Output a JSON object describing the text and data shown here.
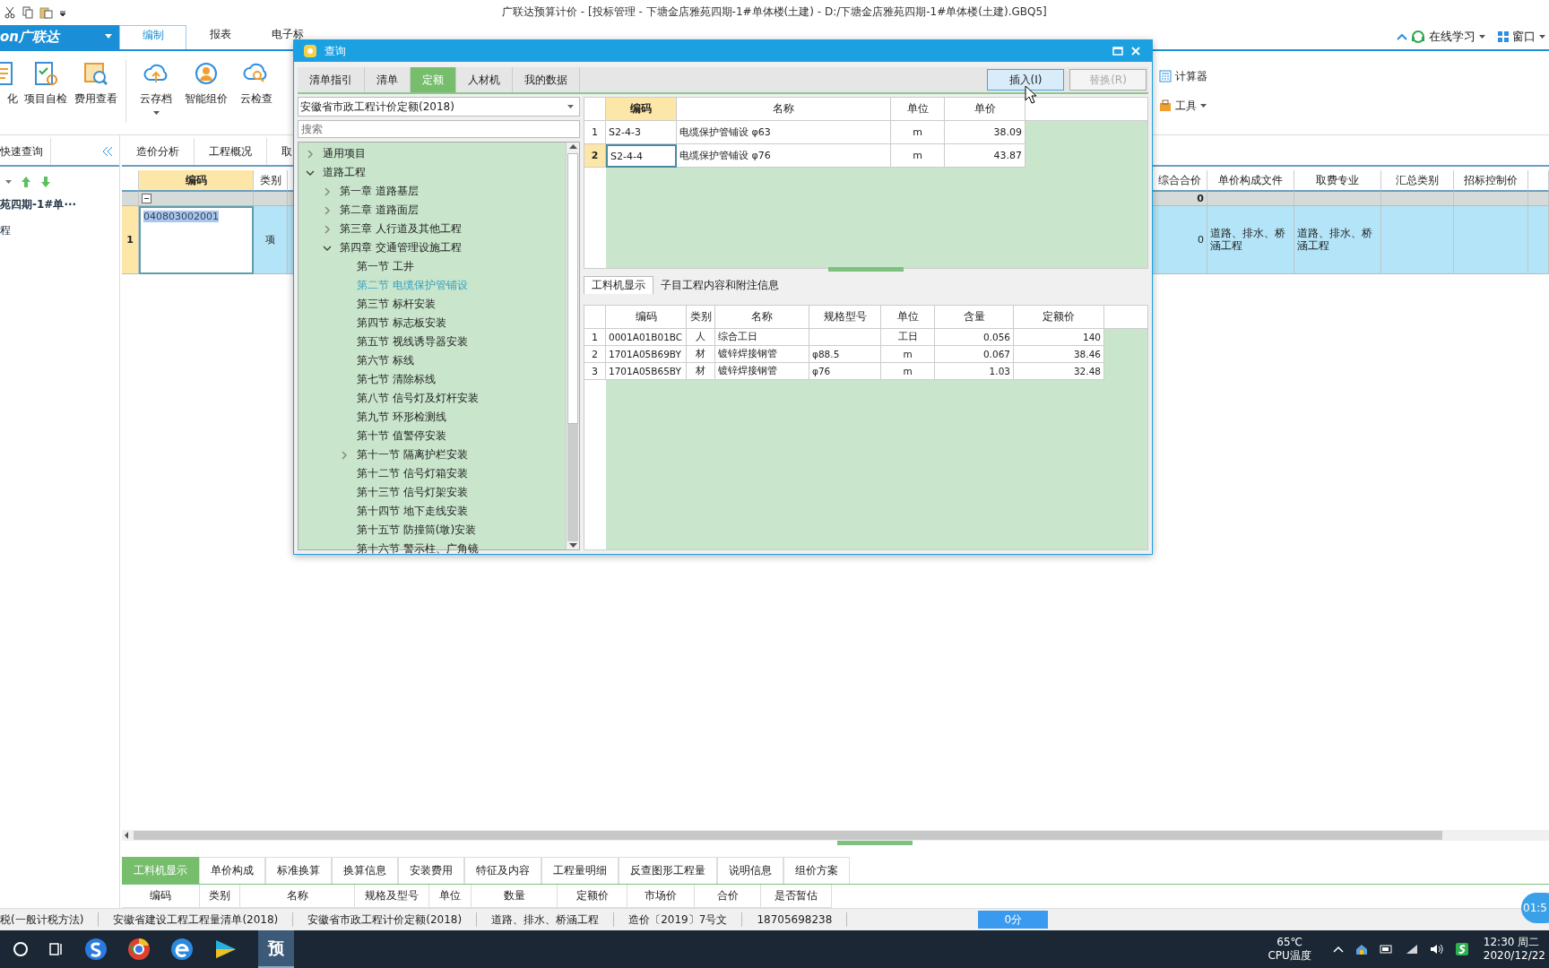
{
  "window": {
    "title": "广联达预算计价 - [投标管理 - 下塘金店雅苑四期-1#单体楼(土建) - D:/下塘金店雅苑四期-1#单体楼(土建).GBQ5]"
  },
  "menu": {
    "brand": "on广联达",
    "tabs": [
      {
        "label": "编制",
        "selected": true
      },
      {
        "label": "报表",
        "selected": false
      },
      {
        "label": "电子标",
        "selected": false
      }
    ],
    "right": [
      {
        "label": "在线学习",
        "kind": "learn"
      },
      {
        "label": "窗口",
        "kind": "window"
      }
    ]
  },
  "ribbon": {
    "left": [
      {
        "label": "化",
        "kind": "doc",
        "dropdown": false
      },
      {
        "label": "项目自检",
        "kind": "check",
        "dropdown": false
      },
      {
        "label": "费用查看",
        "kind": "view",
        "dropdown": false
      },
      {
        "label": "云存档",
        "kind": "cloud",
        "dropdown": true
      },
      {
        "label": "智能组价",
        "kind": "smart",
        "dropdown": false
      },
      {
        "label": "云检查",
        "kind": "cloudcheck",
        "dropdown": false
      }
    ],
    "right": [
      {
        "label": "计算器",
        "kind": "calc",
        "dropdown": false
      },
      {
        "label": "工具",
        "kind": "tools",
        "dropdown": true
      }
    ]
  },
  "left_panel": {
    "tab": "快速查询",
    "tree": [
      {
        "label": "苑四期-1#单···",
        "bold": true
      },
      {
        "label": "程",
        "bold": false
      }
    ]
  },
  "sheet_tabs": [
    "造价分析",
    "工程概况",
    "取"
  ],
  "main_table": {
    "columns": [
      {
        "label": "编码",
        "selected": true
      },
      {
        "label": "类别",
        "selected": false
      },
      {
        "label": "综合合价",
        "selected": false
      },
      {
        "label": "单价构成文件",
        "selected": false
      },
      {
        "label": "取费专业",
        "selected": false
      },
      {
        "label": "汇总类别",
        "selected": false
      },
      {
        "label": "招标控制价",
        "selected": false
      }
    ],
    "rows": [
      {
        "kind": "group",
        "total": "0",
        "expanded": true
      },
      {
        "kind": "item",
        "num": "1",
        "code": "040803002001",
        "type": "项",
        "total": "0",
        "price_file": "道路、排水、桥涵工程",
        "fee_type": "道路、排水、桥涵工程",
        "selected": true
      }
    ]
  },
  "dialog": {
    "title": "查询",
    "tabs": [
      {
        "label": "清单指引",
        "selected": false
      },
      {
        "label": "清单",
        "selected": false
      },
      {
        "label": "定额",
        "selected": true
      },
      {
        "label": "人材机",
        "selected": false
      },
      {
        "label": "我的数据",
        "selected": false
      }
    ],
    "buttons": [
      {
        "label": "插入(I)",
        "disabled": false,
        "hover": true
      },
      {
        "label": "替换(R)",
        "disabled": true,
        "hover": false
      }
    ],
    "library": "安徽省市政工程计价定额(2018)",
    "search": {
      "placeholder": "搜索"
    },
    "tree": [
      {
        "label": "通用项目",
        "expanded": false,
        "selected": false
      },
      {
        "label": "道路工程",
        "expanded": true,
        "selected": false,
        "children": [
          {
            "label": "第一章  道路基层",
            "expanded": false,
            "selected": false
          },
          {
            "label": "第二章  道路面层",
            "expanded": false,
            "selected": false
          },
          {
            "label": "第三章  人行道及其他工程",
            "expanded": false,
            "selected": false
          },
          {
            "label": "第四章  交通管理设施工程",
            "expanded": true,
            "selected": false,
            "children": [
              {
                "label": "第一节  工井",
                "selected": false
              },
              {
                "label": "第二节  电缆保护管铺设",
                "selected": true
              },
              {
                "label": "第三节  标杆安装",
                "selected": false
              },
              {
                "label": "第四节  标志板安装",
                "selected": false
              },
              {
                "label": "第五节  视线诱导器安装",
                "selected": false
              },
              {
                "label": "第六节  标线",
                "selected": false
              },
              {
                "label": "第七节  清除标线",
                "selected": false
              },
              {
                "label": "第八节  信号灯及灯杆安装",
                "selected": false
              },
              {
                "label": "第九节  环形检测线",
                "selected": false
              },
              {
                "label": "第十节  值警停安装",
                "selected": false
              },
              {
                "label": "第十一节  隔离护栏安装",
                "expanded": false,
                "selected": false
              },
              {
                "label": "第十二节  信号灯箱安装",
                "selected": false
              },
              {
                "label": "第十三节  信号灯架安装",
                "selected": false
              },
              {
                "label": "第十四节  地下走线安装",
                "selected": false
              },
              {
                "label": "第十五节  防撞筒(墩)安装",
                "selected": false
              },
              {
                "label": "第十六节  警示柱、广角镜",
                "selected": false
              }
            ]
          }
        ]
      }
    ],
    "quota_columns": [
      "编码",
      "名称",
      "单位",
      "单价"
    ],
    "quota_rows": [
      {
        "num": "1",
        "code": "S2-4-3",
        "name": "电缆保护管铺设  φ63",
        "unit": "m",
        "price": "38.09",
        "selected": false
      },
      {
        "num": "2",
        "code": "S2-4-4",
        "name": "电缆保护管铺设  φ76",
        "unit": "m",
        "price": "43.87",
        "selected": true
      }
    ],
    "detail_tabs": [
      {
        "label": "工料机显示",
        "selected": true
      },
      {
        "label": "子目工程内容和附注信息",
        "selected": false
      }
    ],
    "detail_columns": [
      "编码",
      "类别",
      "名称",
      "规格型号",
      "单位",
      "含量",
      "定额价"
    ],
    "detail_rows": [
      {
        "num": "1",
        "code": "0001A01B01BC",
        "type": "人",
        "name": "综合工日",
        "unit": "工日",
        "amount": "0.056",
        "price": "140"
      },
      {
        "num": "2",
        "code": "1701A05B69BY",
        "type": "材",
        "name": "镀锌焊接钢管",
        "spec": "φ88.5",
        "unit": "m",
        "amount": "0.067",
        "price": "38.46"
      },
      {
        "num": "3",
        "code": "1701A05B65BY",
        "type": "材",
        "name": "镀锌焊接钢管",
        "spec": "φ76",
        "unit": "m",
        "amount": "1.03",
        "price": "32.48"
      }
    ]
  },
  "bottom_tabs": [
    {
      "label": "工料机显示",
      "selected": true
    },
    {
      "label": "单价构成",
      "selected": false
    },
    {
      "label": "标准换算",
      "selected": false
    },
    {
      "label": "换算信息",
      "selected": false
    },
    {
      "label": "安装费用",
      "selected": false
    },
    {
      "label": "特征及内容",
      "selected": false
    },
    {
      "label": "工程量明细",
      "selected": false
    },
    {
      "label": "反查图形工程量",
      "selected": false
    },
    {
      "label": "说明信息",
      "selected": false
    },
    {
      "label": "组价方案",
      "selected": false
    }
  ],
  "bottom_columns": [
    "编码",
    "类别",
    "名称",
    "规格及型号",
    "单位",
    "数量",
    "定额价",
    "市场价",
    "合价",
    "是否暂估"
  ],
  "status_bar": [
    "税(一般计税方法)",
    "安徽省建设工程工程量清单(2018)",
    "安徽省市政工程计价定额(2018)",
    "道路、排水、桥涵工程",
    "造价〔2019〕7号文",
    "18705698238"
  ],
  "score": "0分",
  "timer": "01:5",
  "taskbar": {
    "app_label": "预",
    "temperature": "65℃",
    "temperature_label": "CPU温度",
    "time": "12:30 周二",
    "date": "2020/12/22"
  }
}
